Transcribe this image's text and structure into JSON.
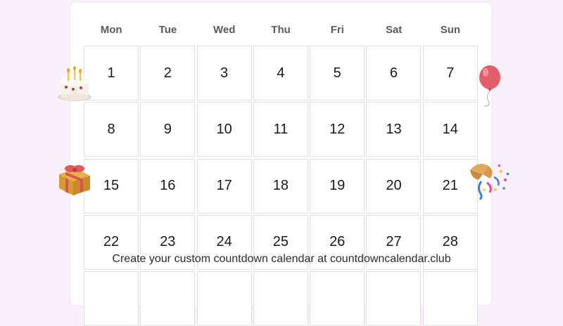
{
  "calendar": {
    "weekdays": [
      "Mon",
      "Tue",
      "Wed",
      "Thu",
      "Fri",
      "Sat",
      "Sun"
    ],
    "days": [
      "1",
      "2",
      "3",
      "4",
      "5",
      "6",
      "7",
      "8",
      "9",
      "10",
      "11",
      "12",
      "13",
      "14",
      "15",
      "16",
      "17",
      "18",
      "19",
      "20",
      "21",
      "22",
      "23",
      "24",
      "25",
      "26",
      "27",
      "28",
      "",
      "",
      "",
      "",
      "",
      "",
      ""
    ]
  },
  "footer": {
    "text": "Create your custom countdown calendar at countdowncalendar.club"
  },
  "decorations": [
    "cake-icon",
    "balloon-icon",
    "gift-icon",
    "party-popper-icon"
  ],
  "colors": {
    "page_background": "#f9f1fa",
    "card_background": "#ffffff",
    "cell_border": "#e0e0e0",
    "weekday_text": "#5b5b5b"
  }
}
